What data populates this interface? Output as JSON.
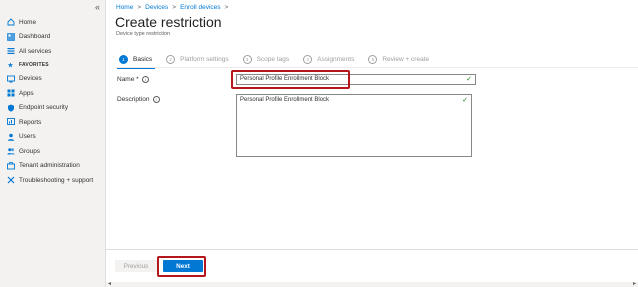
{
  "sidebar": {
    "collapse_glyph": "«",
    "items": [
      {
        "label": "Home",
        "icon": "home-icon"
      },
      {
        "label": "Dashboard",
        "icon": "dashboard-icon"
      },
      {
        "label": "All services",
        "icon": "all-services-icon"
      },
      {
        "label": "FAVORITES",
        "icon": "star-icon"
      },
      {
        "label": "Devices",
        "icon": "devices-icon"
      },
      {
        "label": "Apps",
        "icon": "apps-icon"
      },
      {
        "label": "Endpoint security",
        "icon": "endpoint-security-icon"
      },
      {
        "label": "Reports",
        "icon": "reports-icon"
      },
      {
        "label": "Users",
        "icon": "users-icon"
      },
      {
        "label": "Groups",
        "icon": "groups-icon"
      },
      {
        "label": "Tenant administration",
        "icon": "tenant-admin-icon"
      },
      {
        "label": "Troubleshooting + support",
        "icon": "troubleshooting-icon"
      }
    ]
  },
  "breadcrumb": [
    "Home",
    "Devices",
    "Enroll devices"
  ],
  "page": {
    "title": "Create restriction",
    "subtitle": "Device type restriction"
  },
  "steps": [
    {
      "num": "1",
      "label": "Basics"
    },
    {
      "num": "2",
      "label": "Platform settings"
    },
    {
      "num": "3",
      "label": "Scope tags"
    },
    {
      "num": "4",
      "label": "Assignments"
    },
    {
      "num": "5",
      "label": "Review + create"
    }
  ],
  "form": {
    "name_label": "Name *",
    "name_value": "Personal Profile Enrollment Block",
    "description_label": "Description",
    "description_value": "Personal Profile Enrollment Block"
  },
  "footer": {
    "previous_label": "Previous",
    "next_label": "Next"
  },
  "colors": {
    "accent": "#0078d4",
    "highlight": "#b4161b",
    "valid": "#107c10"
  }
}
